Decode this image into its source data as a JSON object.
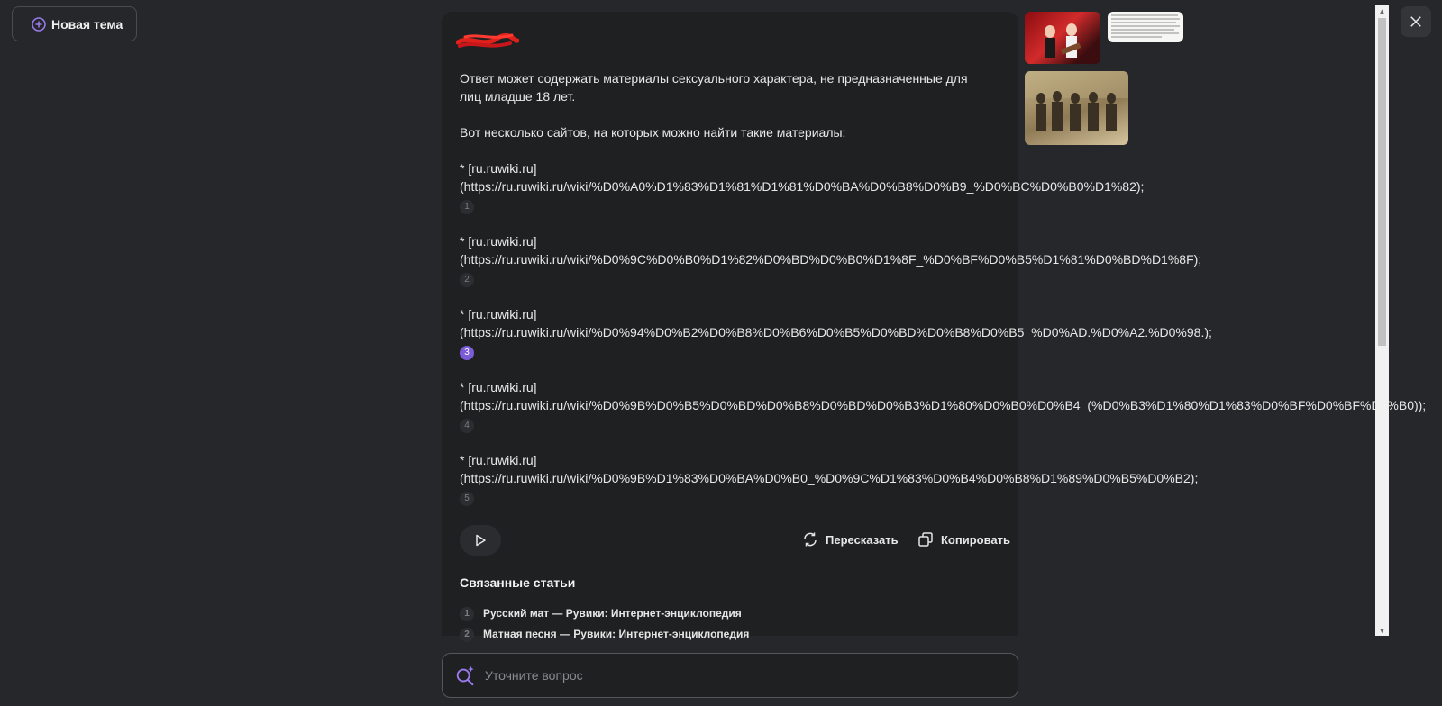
{
  "header": {
    "new_topic_label": "Новая тема"
  },
  "answer": {
    "disclaimer": "Ответ может содержать материалы сексуального характера, не предназначенные для лиц младше 18 лет.",
    "intro": "Вот несколько сайтов, на которых можно найти такие материалы:",
    "links": [
      {
        "label": "* [ru.ruwiki.ru]",
        "url": "(https://ru.ruwiki.ru/wiki/%D0%A0%D1%83%D1%81%D1%81%D0%BA%D0%B8%D0%B9_%D0%BC%D0%B0%D1%82);",
        "ref": "1",
        "active": false
      },
      {
        "label": "* [ru.ruwiki.ru]",
        "url": "(https://ru.ruwiki.ru/wiki/%D0%9C%D0%B0%D1%82%D0%BD%D0%B0%D1%8F_%D0%BF%D0%B5%D1%81%D0%BD%D1%8F);",
        "ref": "2",
        "active": false
      },
      {
        "label": "* [ru.ruwiki.ru]",
        "url": "(https://ru.ruwiki.ru/wiki/%D0%94%D0%B2%D0%B8%D0%B6%D0%B5%D0%BD%D0%B8%D0%B5_%D0%AD.%D0%A2.%D0%98.);",
        "ref": "3",
        "active": true
      },
      {
        "label": "* [ru.ruwiki.ru]",
        "url": "(https://ru.ruwiki.ru/wiki/%D0%9B%D0%B5%D0%BD%D0%B8%D0%BD%D0%B3%D1%80%D0%B0%D0%B4_(%D0%B3%D1%80%D1%83%D0%BF%D0%BF%D0%B0));",
        "ref": "4",
        "active": false
      },
      {
        "label": "* [ru.ruwiki.ru]",
        "url": "(https://ru.ruwiki.ru/wiki/%D0%9B%D1%83%D0%BA%D0%B0_%D0%9C%D1%83%D0%B4%D0%B8%D1%89%D0%B5%D0%B2);",
        "ref": "5",
        "active": false
      }
    ],
    "actions": {
      "retell": "Пересказать",
      "copy": "Копировать"
    },
    "related_title": "Связанные статьи",
    "related": [
      {
        "num": "1",
        "title": "Русский мат — Рувики: Интернет-энциклопедия"
      },
      {
        "num": "2",
        "title": "Матная песня — Рувики: Интернет-энциклопедия"
      }
    ]
  },
  "search": {
    "placeholder": "Уточните вопрос"
  },
  "colors": {
    "accent": "#7b5cd6",
    "background": "#26272a",
    "panel": "#1f2022"
  },
  "icons": [
    "plus-circle-icon",
    "close-icon",
    "play-icon",
    "retell-icon",
    "copy-icon",
    "search-sparkle-icon"
  ]
}
